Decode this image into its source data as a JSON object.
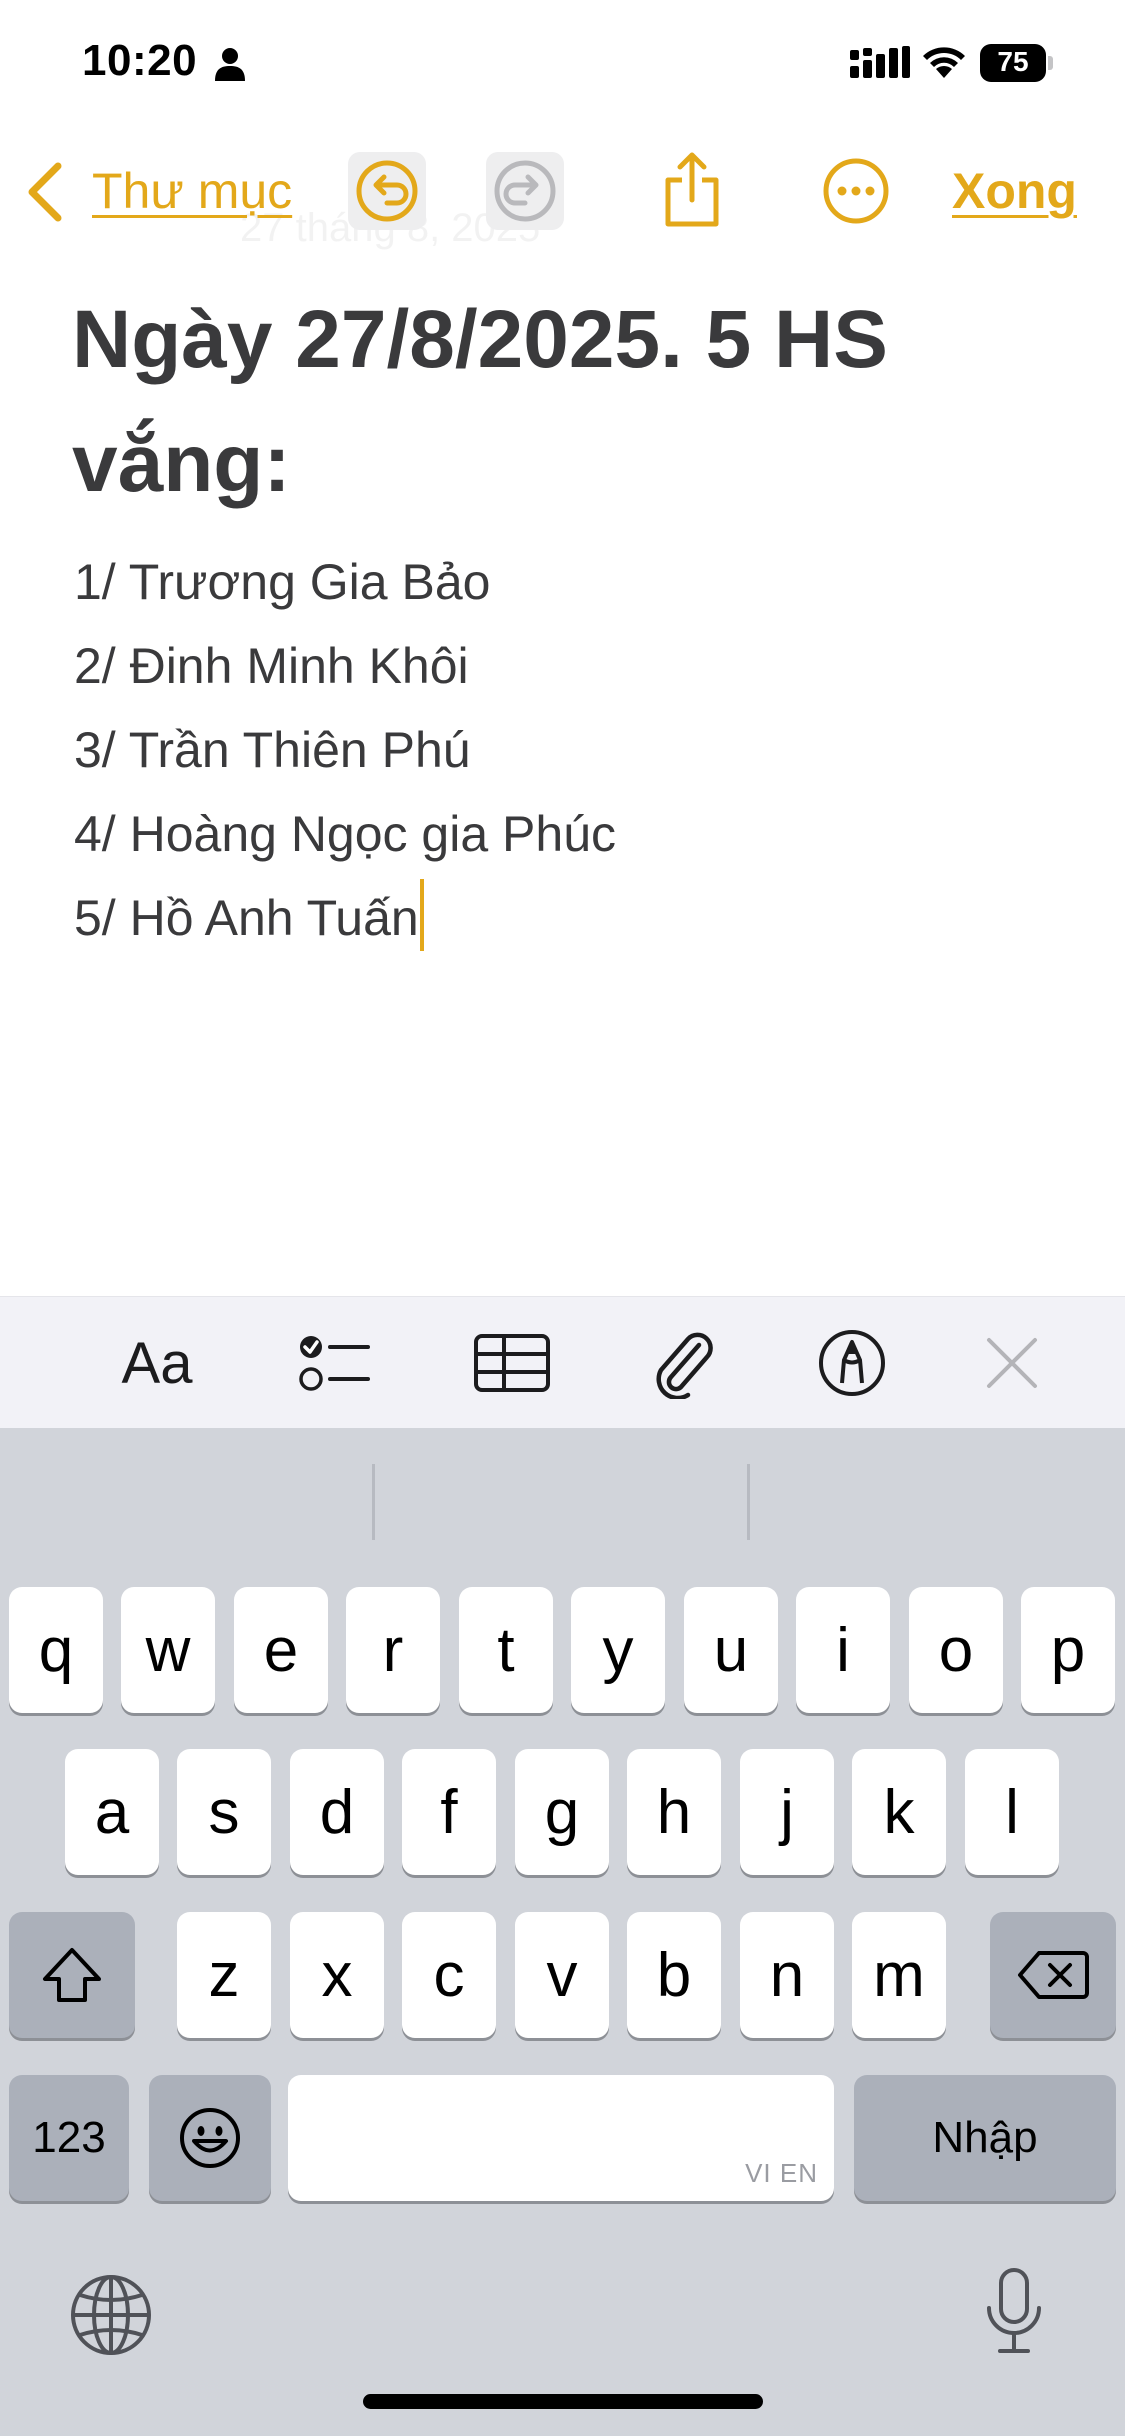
{
  "status_bar": {
    "time": "10:20",
    "battery": "75",
    "icons": [
      "person-icon",
      "cellular-signal-icon",
      "wifi-icon",
      "battery-icon"
    ]
  },
  "nav": {
    "back_label": "Thư mục",
    "done_label": "Xong",
    "ghost_text": "27 tháng 8, 2025",
    "icons": [
      "chevron-left-icon",
      "undo-icon",
      "redo-icon",
      "share-icon",
      "more-icon"
    ]
  },
  "note": {
    "title": "Ngày 27/8/2025. 5 HS vắng:",
    "lines": [
      "1/ Trương Gia Bảo",
      "2/ Đinh Minh Khôi",
      "3/ Trần Thiên Phú",
      "4/ Hoàng Ngọc gia Phúc",
      "5/ Hồ Anh Tuấn"
    ]
  },
  "format_toolbar": {
    "aa_label": "Aa",
    "icons": [
      "checklist-icon",
      "table-icon",
      "attachment-icon",
      "markup-icon",
      "close-icon"
    ]
  },
  "keyboard": {
    "row1": [
      "q",
      "w",
      "e",
      "r",
      "t",
      "y",
      "u",
      "i",
      "o",
      "p"
    ],
    "row2": [
      "a",
      "s",
      "d",
      "f",
      "g",
      "h",
      "j",
      "k",
      "l"
    ],
    "row3": [
      "z",
      "x",
      "c",
      "v",
      "b",
      "n",
      "m"
    ],
    "numbers_label": "123",
    "return_label": "Nhập",
    "space_hint": "VI EN",
    "icons": [
      "shift-icon",
      "backspace-icon",
      "emoji-icon",
      "globe-icon",
      "microphone-icon"
    ]
  },
  "colors": {
    "accent": "#e3a81a",
    "keyboard_bg": "#d1d4da",
    "key_dark": "#abb0ba",
    "text": "#3a3a3c"
  }
}
